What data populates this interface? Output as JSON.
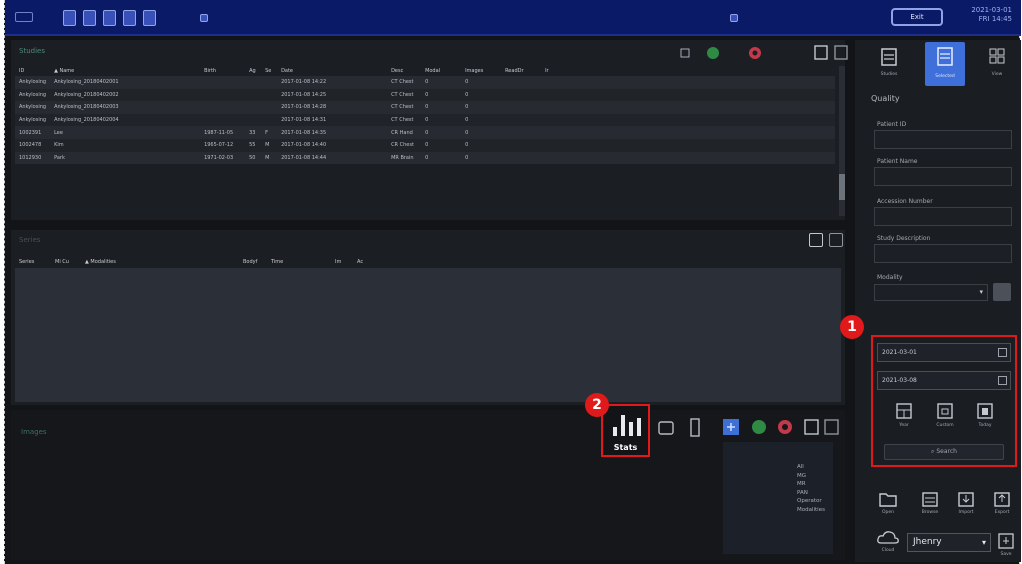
{
  "topbar": {
    "button_label": "Exit",
    "clock_line1": "2021-03-01",
    "clock_line2": "FRI 14:45"
  },
  "study_panel": {
    "title": "Studies",
    "columns": [
      "ID",
      "▲ Name",
      "Birth",
      "Ag",
      "Se",
      "Date",
      "Desc",
      "Modal",
      "Images",
      "ReadDr",
      "Ir"
    ],
    "rows": [
      [
        "Ankylosing",
        "Ankylosing_20180402001",
        "",
        "",
        "",
        "2017-01-08 14:22",
        "CT Chest",
        "0",
        "0",
        "",
        ""
      ],
      [
        "Ankylosing",
        "Ankylosing_20180402002",
        "",
        "",
        "",
        "2017-01-08 14:25",
        "CT Chest",
        "0",
        "0",
        "",
        ""
      ],
      [
        "Ankylosing",
        "Ankylosing_20180402003",
        "",
        "",
        "",
        "2017-01-08 14:28",
        "CT Chest",
        "0",
        "0",
        "",
        ""
      ],
      [
        "Ankylosing",
        "Ankylosing_20180402004",
        "",
        "",
        "",
        "2017-01-08 14:31",
        "CT Chest",
        "0",
        "0",
        "",
        ""
      ],
      [
        "1002391",
        "Lee",
        "1987-11-05",
        "33",
        "F",
        "2017-01-08 14:35",
        "CR Hand",
        "0",
        "0",
        "",
        ""
      ],
      [
        "1002478",
        "Kim",
        "1965-07-12",
        "55",
        "M",
        "2017-01-08 14:40",
        "CR Chest",
        "0",
        "0",
        "",
        ""
      ],
      [
        "1012930",
        "Park",
        "1971-02-03",
        "50",
        "M",
        "2017-01-08 14:44",
        "MR Brain",
        "0",
        "0",
        "",
        ""
      ]
    ]
  },
  "series_panel": {
    "title": "Series",
    "columns": [
      "Series",
      "Mi Cu",
      "▲ Modalities",
      "",
      "Bodyf",
      "Time",
      "",
      "Im",
      "Ac"
    ]
  },
  "image_panel": {
    "title": "Images"
  },
  "stats_button": {
    "label": "Stats"
  },
  "legend_items": [
    "All",
    "MG",
    "MR",
    "PAN",
    "Operator",
    "Modalities"
  ],
  "right_panel": {
    "tabs": [
      "Studies",
      "Selected",
      "View"
    ],
    "section_title": "Quality",
    "fields": [
      {
        "label": "Patient ID"
      },
      {
        "label": "Patient Name"
      },
      {
        "label": "Accession Number"
      },
      {
        "label": "Study Description"
      }
    ],
    "dropdown_label": "Modality",
    "date_from": "2021-03-01",
    "date_to": "2021-03-08",
    "search_tools": [
      "Year",
      "Custom",
      "Today"
    ],
    "search_button": "Search",
    "bottom_tools": [
      "Open",
      "Browse",
      "Import",
      "Export"
    ],
    "cloud_label": "Cloud",
    "user_select": "Jhenry",
    "extra_label": "Save"
  },
  "annotations": {
    "badge1": "1",
    "badge2": "2"
  },
  "colors": {
    "topbar": "#0b1a66",
    "background": "#121418",
    "panel": "#1b1e23",
    "highlight": "#e01a1a",
    "accent": "#3d6fd6"
  }
}
